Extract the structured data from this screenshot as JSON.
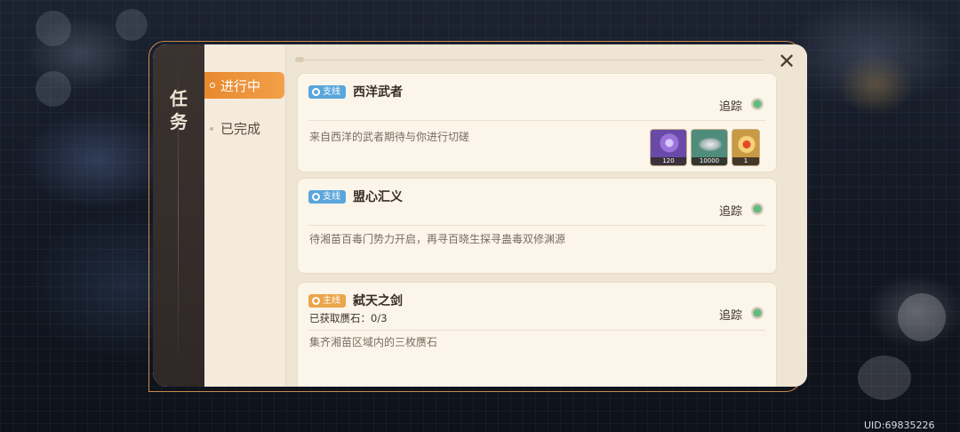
{
  "panel": {
    "title": "任务",
    "close_icon": "close-icon"
  },
  "tabs": [
    {
      "label": "进行中",
      "active": true
    },
    {
      "label": "已完成",
      "active": false
    }
  ],
  "quests": [
    {
      "tag": "支线",
      "tag_color": "#5aa6dc",
      "title": "西洋武者",
      "track_label": "追踪",
      "description": "来自西洋的武者期待与你进行切磋",
      "rewards": [
        {
          "icon": "purple-crystal-icon",
          "qty": "120"
        },
        {
          "icon": "coin-pile-icon",
          "qty": "10000"
        },
        {
          "icon": "gold-medal-icon",
          "qty": "1"
        }
      ]
    },
    {
      "tag": "支线",
      "tag_color": "#5aa6dc",
      "title": "盟心汇义",
      "track_label": "追踪",
      "description": "待湘苗百毒门势力开启，再寻百晓生探寻蛊毒双修渊源"
    },
    {
      "tag": "主线",
      "tag_color": "#eba54a",
      "title": "弑天之剑",
      "track_label": "追踪",
      "progress": "已获取赝石：0/3",
      "description": "集齐湘苗区域内的三枚赝石"
    }
  ],
  "uid": "UID:69835226",
  "colors": {
    "accent": "#e8892e",
    "track_on": "#5fbf7a",
    "sidebar": "#3b3330"
  }
}
